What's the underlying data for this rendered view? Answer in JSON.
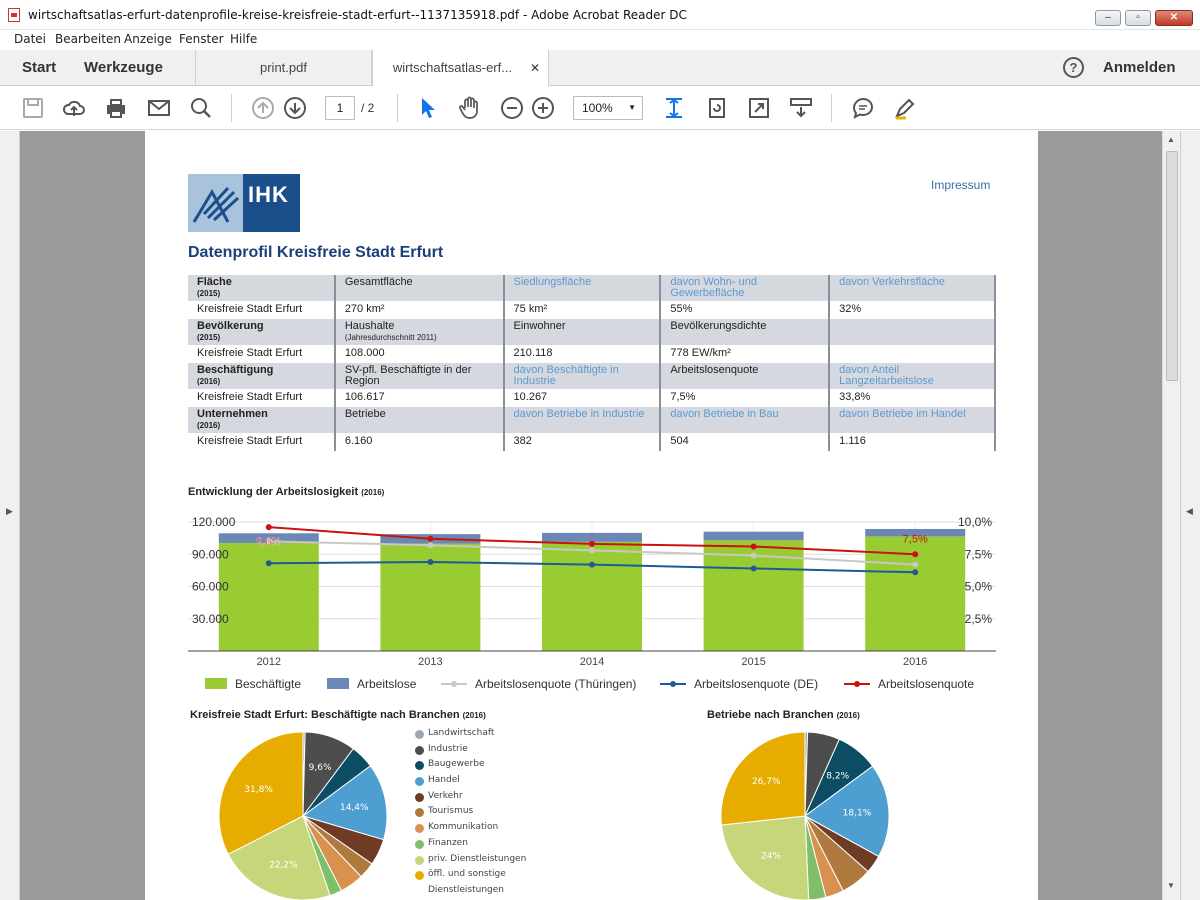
{
  "window": {
    "title": "wirtschaftsatlas-erfurt-datenprofile-kreise-kreisfreie-stadt-erfurt--1137135918.pdf - Adobe Acrobat Reader DC"
  },
  "menu": [
    "Datei",
    "Bearbeiten",
    "Anzeige",
    "Fenster",
    "Hilfe"
  ],
  "tabs": {
    "start": "Start",
    "tools": "Werkzeuge",
    "doc1": "print.pdf",
    "doc2": "wirtschaftsatlas-erf...",
    "signin": "Anmelden"
  },
  "toolbar": {
    "page_current": "1",
    "page_total": "/  2",
    "zoom": "100%"
  },
  "document": {
    "logo_text": "IHK",
    "impressum": "Impressum",
    "title": "Datenprofil Kreisfreie Stadt Erfurt",
    "table": [
      {
        "header": [
          "Fläche",
          "(2015)",
          "Gesamtfläche",
          "",
          "Siedlungsfläche",
          "davon Wohn- und Gewerbefläche",
          "davon Verkehrsfläche"
        ],
        "values": [
          "Kreisfreie Stadt Erfurt",
          "270 km²",
          "75 km²",
          "55%",
          "32%"
        ]
      },
      {
        "header": [
          "Bevölkerung",
          "(2015)",
          "Haushalte",
          "(Jahresdurchschnitt 2011)",
          "Einwohner",
          "Bevölkerungsdichte",
          ""
        ],
        "values": [
          "Kreisfreie Stadt Erfurt",
          "108.000",
          "210.118",
          "778 EW/km²",
          ""
        ]
      },
      {
        "header": [
          "Beschäftigung",
          "(2016)",
          "SV-pfl. Beschäftigte in der Region",
          "",
          "davon Beschäftigte in Industrie",
          "Arbeitslosenquote",
          "davon Anteil Langzeitarbeitslose"
        ],
        "values": [
          "Kreisfreie Stadt Erfurt",
          "106.617",
          "10.267",
          "7,5%",
          "33,8%"
        ]
      },
      {
        "header": [
          "Unternehmen",
          "(2016)",
          "Betriebe",
          "",
          "davon Betriebe in Industrie",
          "davon Betriebe in Bau",
          "davon Betriebe im Handel"
        ],
        "values": [
          "Kreisfreie Stadt Erfurt",
          "6.160",
          "382",
          "504",
          "1.116"
        ]
      }
    ],
    "chart1_title": "Entwicklung der Arbeitslosigkeit",
    "chart1_year": "(2016)",
    "chart2_title": "Kreisfreie Stadt Erfurt: Beschäftigte nach Branchen",
    "chart2_year": "(2016)",
    "chart3_title": "Betriebe nach Branchen",
    "chart3_year": "(2016)"
  },
  "chart_data": [
    {
      "type": "bar",
      "categories": [
        "2012",
        "2013",
        "2014",
        "2015",
        "2016"
      ],
      "yticks": [
        "30.000",
        "60.000",
        "90.000",
        "120.000"
      ],
      "ylim": [
        0,
        120000
      ],
      "y2ticks": [
        "2,5%",
        "5,0%",
        "7,5%",
        "10,0%"
      ],
      "y2lim": [
        0,
        10
      ],
      "series": [
        {
          "name": "Beschäftigte",
          "kind": "bar",
          "color": "#99cc33",
          "values": [
            100500,
            100000,
            101500,
            103000,
            106617
          ]
        },
        {
          "name": "Arbeitslose",
          "kind": "bar",
          "color": "#6b88b5",
          "values": [
            9000,
            8700,
            8400,
            8000,
            6900
          ]
        },
        {
          "name": "Arbeitslosenquote (Thüringen)",
          "kind": "line",
          "color": "#c8c8c8",
          "values": [
            8.5,
            8.2,
            7.8,
            7.4,
            6.7
          ]
        },
        {
          "name": "Arbeitslosenquote (DE)",
          "kind": "line",
          "color": "#1f5a96",
          "values": [
            6.8,
            6.9,
            6.7,
            6.4,
            6.1
          ]
        },
        {
          "name": "Arbeitslosenquote",
          "kind": "line",
          "color": "#cc1111",
          "values": [
            9.6,
            8.7,
            8.3,
            8.1,
            7.5
          ]
        }
      ],
      "labels": [
        "9,6%",
        "7,5%"
      ],
      "legend": "bottom",
      "grid": true
    },
    {
      "type": "pie",
      "title": "Kreisfreie Stadt Erfurt: Beschäftigte nach Branchen",
      "slices": [
        {
          "name": "Landwirtschaft",
          "value": 0.4,
          "color": "#9aa7b3"
        },
        {
          "name": "Industrie",
          "value": 9.6,
          "color": "#4d4d4d",
          "label": "9,6%"
        },
        {
          "name": "Baugewerbe",
          "value": 4.5,
          "color": "#0d4d63"
        },
        {
          "name": "Handel",
          "value": 14.4,
          "color": "#4e9fd1",
          "label": "14,4%"
        },
        {
          "name": "Verkehr",
          "value": 5.0,
          "color": "#6e3b24"
        },
        {
          "name": "Tourismus",
          "value": 3.1,
          "color": "#b07a3f"
        },
        {
          "name": "Kommunikation",
          "value": 4.5,
          "color": "#d9914f"
        },
        {
          "name": "Finanzen",
          "value": 2.3,
          "color": "#7fbf6a"
        },
        {
          "name": "priv. Dienstleistungen",
          "value": 22.2,
          "color": "#c5d77a",
          "label": "22,2%"
        },
        {
          "name": "öffl. und sonstige Dienstleistungen",
          "value": 31.8,
          "color": "#e6ad00",
          "label": "31,8%"
        }
      ],
      "legend_labels": [
        "Landwirtschaft",
        "Industrie",
        "Baugewerbe",
        "Handel",
        "Verkehr",
        "Tourismus",
        "Kommunikation",
        "Finanzen",
        "priv. Dienstleistungen",
        "öffl. und sonstige",
        "Dienstleistungen"
      ]
    },
    {
      "type": "pie",
      "title": "Betriebe nach Branchen",
      "slices": [
        {
          "name": "Landwirtschaft",
          "value": 0.5,
          "color": "#9aa7b3"
        },
        {
          "name": "Industrie",
          "value": 6.2,
          "color": "#4d4d4d"
        },
        {
          "name": "Baugewerbe",
          "value": 8.2,
          "color": "#0d4d63",
          "label": "8,2%"
        },
        {
          "name": "Handel",
          "value": 18.1,
          "color": "#4e9fd1",
          "label": "18,1%"
        },
        {
          "name": "Verkehr",
          "value": 3.5,
          "color": "#6e3b24"
        },
        {
          "name": "Tourismus",
          "value": 6.0,
          "color": "#b07a3f"
        },
        {
          "name": "Kommunikation",
          "value": 3.5,
          "color": "#d9914f"
        },
        {
          "name": "Finanzen",
          "value": 3.3,
          "color": "#7fbf6a"
        },
        {
          "name": "priv. Dienstleistungen",
          "value": 24.0,
          "color": "#c5d77a",
          "label": "24%"
        },
        {
          "name": "öffl. und sonstige Dienstleistungen",
          "value": 26.7,
          "color": "#e6ad00",
          "label": "26,7%"
        }
      ]
    }
  ]
}
